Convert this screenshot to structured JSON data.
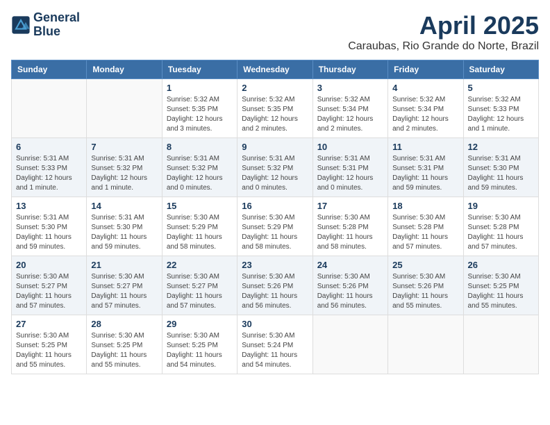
{
  "header": {
    "logo_line1": "General",
    "logo_line2": "Blue",
    "month": "April 2025",
    "location": "Caraubas, Rio Grande do Norte, Brazil"
  },
  "weekdays": [
    "Sunday",
    "Monday",
    "Tuesday",
    "Wednesday",
    "Thursday",
    "Friday",
    "Saturday"
  ],
  "weeks": [
    [
      {
        "day": "",
        "info": ""
      },
      {
        "day": "",
        "info": ""
      },
      {
        "day": "1",
        "info": "Sunrise: 5:32 AM\nSunset: 5:35 PM\nDaylight: 12 hours and 3 minutes."
      },
      {
        "day": "2",
        "info": "Sunrise: 5:32 AM\nSunset: 5:35 PM\nDaylight: 12 hours and 2 minutes."
      },
      {
        "day": "3",
        "info": "Sunrise: 5:32 AM\nSunset: 5:34 PM\nDaylight: 12 hours and 2 minutes."
      },
      {
        "day": "4",
        "info": "Sunrise: 5:32 AM\nSunset: 5:34 PM\nDaylight: 12 hours and 2 minutes."
      },
      {
        "day": "5",
        "info": "Sunrise: 5:32 AM\nSunset: 5:33 PM\nDaylight: 12 hours and 1 minute."
      }
    ],
    [
      {
        "day": "6",
        "info": "Sunrise: 5:31 AM\nSunset: 5:33 PM\nDaylight: 12 hours and 1 minute."
      },
      {
        "day": "7",
        "info": "Sunrise: 5:31 AM\nSunset: 5:32 PM\nDaylight: 12 hours and 1 minute."
      },
      {
        "day": "8",
        "info": "Sunrise: 5:31 AM\nSunset: 5:32 PM\nDaylight: 12 hours and 0 minutes."
      },
      {
        "day": "9",
        "info": "Sunrise: 5:31 AM\nSunset: 5:32 PM\nDaylight: 12 hours and 0 minutes."
      },
      {
        "day": "10",
        "info": "Sunrise: 5:31 AM\nSunset: 5:31 PM\nDaylight: 12 hours and 0 minutes."
      },
      {
        "day": "11",
        "info": "Sunrise: 5:31 AM\nSunset: 5:31 PM\nDaylight: 11 hours and 59 minutes."
      },
      {
        "day": "12",
        "info": "Sunrise: 5:31 AM\nSunset: 5:30 PM\nDaylight: 11 hours and 59 minutes."
      }
    ],
    [
      {
        "day": "13",
        "info": "Sunrise: 5:31 AM\nSunset: 5:30 PM\nDaylight: 11 hours and 59 minutes."
      },
      {
        "day": "14",
        "info": "Sunrise: 5:31 AM\nSunset: 5:30 PM\nDaylight: 11 hours and 59 minutes."
      },
      {
        "day": "15",
        "info": "Sunrise: 5:30 AM\nSunset: 5:29 PM\nDaylight: 11 hours and 58 minutes."
      },
      {
        "day": "16",
        "info": "Sunrise: 5:30 AM\nSunset: 5:29 PM\nDaylight: 11 hours and 58 minutes."
      },
      {
        "day": "17",
        "info": "Sunrise: 5:30 AM\nSunset: 5:28 PM\nDaylight: 11 hours and 58 minutes."
      },
      {
        "day": "18",
        "info": "Sunrise: 5:30 AM\nSunset: 5:28 PM\nDaylight: 11 hours and 57 minutes."
      },
      {
        "day": "19",
        "info": "Sunrise: 5:30 AM\nSunset: 5:28 PM\nDaylight: 11 hours and 57 minutes."
      }
    ],
    [
      {
        "day": "20",
        "info": "Sunrise: 5:30 AM\nSunset: 5:27 PM\nDaylight: 11 hours and 57 minutes."
      },
      {
        "day": "21",
        "info": "Sunrise: 5:30 AM\nSunset: 5:27 PM\nDaylight: 11 hours and 57 minutes."
      },
      {
        "day": "22",
        "info": "Sunrise: 5:30 AM\nSunset: 5:27 PM\nDaylight: 11 hours and 57 minutes."
      },
      {
        "day": "23",
        "info": "Sunrise: 5:30 AM\nSunset: 5:26 PM\nDaylight: 11 hours and 56 minutes."
      },
      {
        "day": "24",
        "info": "Sunrise: 5:30 AM\nSunset: 5:26 PM\nDaylight: 11 hours and 56 minutes."
      },
      {
        "day": "25",
        "info": "Sunrise: 5:30 AM\nSunset: 5:26 PM\nDaylight: 11 hours and 55 minutes."
      },
      {
        "day": "26",
        "info": "Sunrise: 5:30 AM\nSunset: 5:25 PM\nDaylight: 11 hours and 55 minutes."
      }
    ],
    [
      {
        "day": "27",
        "info": "Sunrise: 5:30 AM\nSunset: 5:25 PM\nDaylight: 11 hours and 55 minutes."
      },
      {
        "day": "28",
        "info": "Sunrise: 5:30 AM\nSunset: 5:25 PM\nDaylight: 11 hours and 55 minutes."
      },
      {
        "day": "29",
        "info": "Sunrise: 5:30 AM\nSunset: 5:25 PM\nDaylight: 11 hours and 54 minutes."
      },
      {
        "day": "30",
        "info": "Sunrise: 5:30 AM\nSunset: 5:24 PM\nDaylight: 11 hours and 54 minutes."
      },
      {
        "day": "",
        "info": ""
      },
      {
        "day": "",
        "info": ""
      },
      {
        "day": "",
        "info": ""
      }
    ]
  ]
}
